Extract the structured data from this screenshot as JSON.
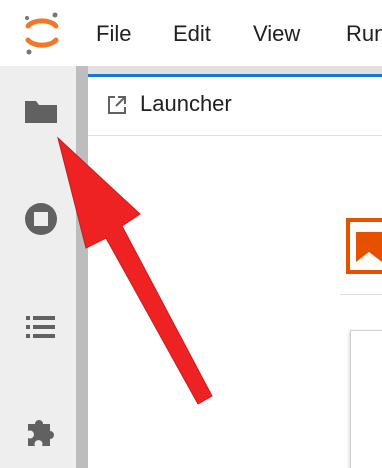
{
  "menubar": {
    "items": [
      {
        "label": "File"
      },
      {
        "label": "Edit"
      },
      {
        "label": "View"
      },
      {
        "label": "Run"
      }
    ]
  },
  "sidebar": {
    "icons": [
      "folder-icon",
      "running-icon",
      "table-of-contents-icon",
      "extension-icon"
    ]
  },
  "tab": {
    "label": "Launcher",
    "icon": "launcher-icon"
  },
  "colors": {
    "logo_orange": "#f37726",
    "accent_blue": "#1976d2",
    "launcher_orange": "#e65100",
    "annotation_red": "#ee2222"
  }
}
